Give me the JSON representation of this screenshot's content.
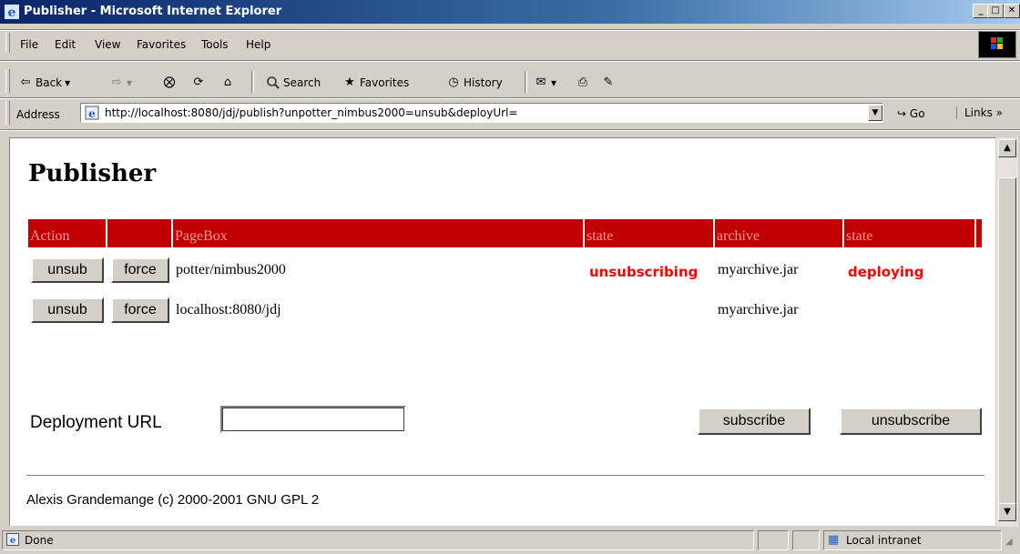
{
  "window": {
    "title": "Publisher - Microsoft Internet Explorer",
    "minimize": "_",
    "maximize": "□",
    "close": "✕"
  },
  "menu": {
    "items": [
      "File",
      "Edit",
      "View",
      "Favorites",
      "Tools",
      "Help"
    ]
  },
  "toolbar": {
    "back": "Back",
    "back_arrow": "⇦",
    "forward_arrow": "⇨",
    "dropdown_arrow": "▾",
    "stop": "⨂",
    "refresh": "⟳",
    "home": "⌂",
    "search": "Search",
    "favorites": "Favorites",
    "history": "History",
    "mail": "✉",
    "print": "⎙",
    "edit": "✎"
  },
  "address": {
    "label": "Address",
    "url": "http://localhost:8080/jdj/publish?unpotter_nimbus2000=unsub&deployUrl=",
    "go": "Go",
    "go_arrow": "↪",
    "links": "Links »",
    "drop": "▼"
  },
  "page": {
    "title": "Publisher",
    "columns": [
      "Action",
      "",
      "PageBox",
      "state",
      "archive",
      "state"
    ],
    "rows": [
      {
        "unsub": "unsub",
        "force": "force",
        "pagebox": "potter/nimbus2000",
        "state": "unsubscribing",
        "archive": "myarchive.jar",
        "archive_state": "deploying"
      },
      {
        "unsub": "unsub",
        "force": "force",
        "pagebox": "localhost:8080/jdj",
        "state": "",
        "archive": "myarchive.jar",
        "archive_state": ""
      }
    ],
    "deployment_label": "Deployment URL",
    "deployment_value": "",
    "subscribe": "subscribe",
    "unsubscribe": "unsubscribe",
    "footer": "Alexis Grandemange (c) 2000-2001 GNU GPL 2"
  },
  "scroll": {
    "up": "▲",
    "down": "▼"
  },
  "status": {
    "text": "Done",
    "zone": "Local intranet"
  },
  "colors": {
    "header_bg": "#c00000",
    "header_text": "#ff9999",
    "state_text": "#ff0000"
  }
}
